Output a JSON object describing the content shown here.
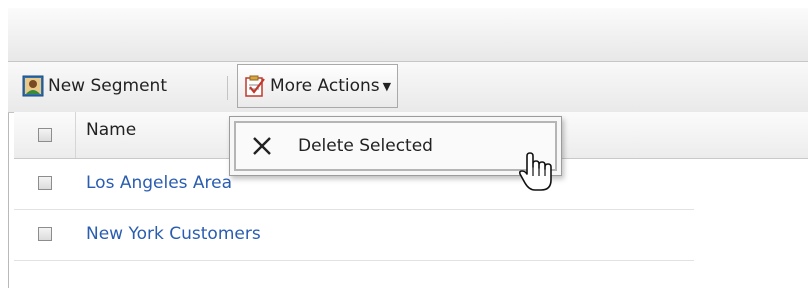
{
  "toolbar": {
    "new_segment_label": "New Segment",
    "more_actions_label": "More Actions",
    "more_actions_caret": "▼"
  },
  "grid": {
    "header": {
      "name_label": "Name"
    },
    "rows": [
      {
        "name": "Los Angeles Area"
      },
      {
        "name": "New York Customers"
      }
    ]
  },
  "menu": {
    "items": [
      {
        "label": "Delete Selected",
        "icon": "close-icon"
      }
    ]
  },
  "colors": {
    "link": "#2a5db0",
    "toolbar_bg": "#eeeeee"
  }
}
